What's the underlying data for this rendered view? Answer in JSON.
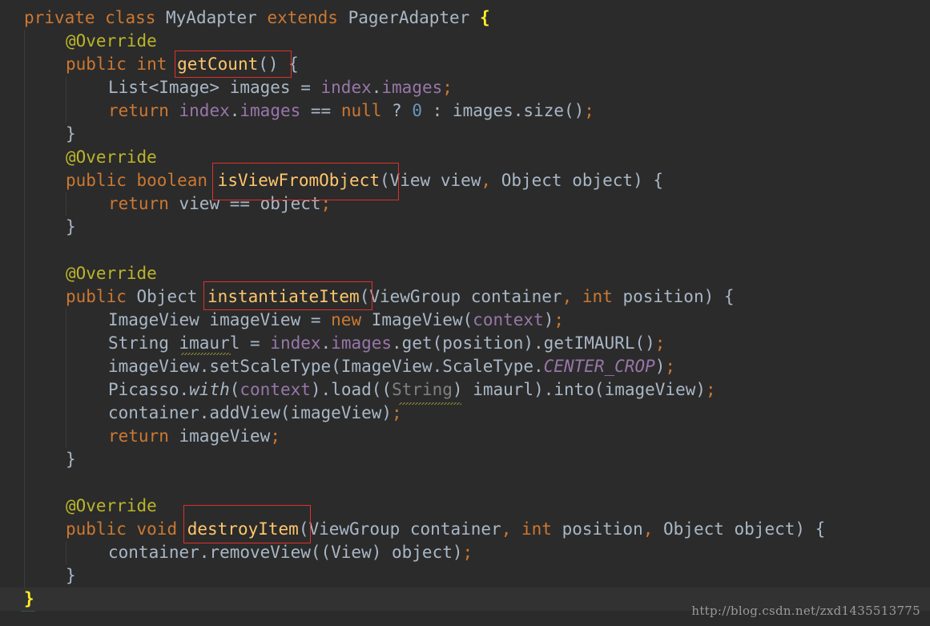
{
  "code": {
    "lines": [
      [
        [
          "k",
          "private "
        ],
        [
          "k",
          "class "
        ],
        [
          "t",
          "MyAdapter "
        ],
        [
          "k",
          "extends "
        ],
        [
          "t",
          "PagerAdapter "
        ],
        [
          "b",
          "{"
        ]
      ],
      [
        [
          "a",
          "@Override"
        ]
      ],
      [
        [
          "k",
          "public "
        ],
        [
          "k",
          "int "
        ],
        [
          "f",
          "getCount"
        ],
        [
          "t",
          "() {"
        ]
      ],
      [
        [
          "t",
          "List<Image> images = "
        ],
        [
          "p",
          "index"
        ],
        [
          "t",
          "."
        ],
        [
          "p",
          "images"
        ],
        [
          "k",
          ";"
        ]
      ],
      [
        [
          "k",
          "return "
        ],
        [
          "p",
          "index"
        ],
        [
          "t",
          "."
        ],
        [
          "p",
          "images"
        ],
        [
          "t",
          " == "
        ],
        [
          "k",
          "null "
        ],
        [
          "t",
          "? "
        ],
        [
          "n",
          "0"
        ],
        [
          "t",
          " : images.size()"
        ],
        [
          "k",
          ";"
        ]
      ],
      [
        [
          "t",
          "}"
        ]
      ],
      [
        [
          "a",
          "@Override"
        ]
      ],
      [
        [
          "k",
          "public "
        ],
        [
          "k",
          "boolean "
        ],
        [
          "f",
          "isViewFromObject"
        ],
        [
          "t",
          "(View view"
        ],
        [
          "k",
          ", "
        ],
        [
          "t",
          "Object object) {"
        ]
      ],
      [
        [
          "k",
          "return "
        ],
        [
          "t",
          "view == object"
        ],
        [
          "k",
          ";"
        ]
      ],
      [
        [
          "t",
          "}"
        ]
      ],
      [],
      [
        [
          "a",
          "@Override"
        ]
      ],
      [
        [
          "k",
          "public "
        ],
        [
          "t",
          "Object "
        ],
        [
          "f",
          "instantiateItem"
        ],
        [
          "t",
          "(ViewGroup container"
        ],
        [
          "k",
          ", "
        ],
        [
          "k",
          "int "
        ],
        [
          "t",
          "position) {"
        ]
      ],
      [
        [
          "t",
          "ImageView imageView = "
        ],
        [
          "k",
          "new "
        ],
        [
          "t",
          "ImageView("
        ],
        [
          "p",
          "context"
        ],
        [
          "t",
          ")"
        ],
        [
          "k",
          ";"
        ]
      ],
      [
        [
          "t",
          "String imaurl = "
        ],
        [
          "p",
          "index"
        ],
        [
          "t",
          "."
        ],
        [
          "p",
          "images"
        ],
        [
          "t",
          ".get(position).getIMAURL()"
        ],
        [
          "k",
          ";"
        ]
      ],
      [
        [
          "t",
          "imageView.setScaleType(ImageView.ScaleType."
        ],
        [
          "s",
          "CENTER_CROP"
        ],
        [
          "t",
          ")"
        ],
        [
          "k",
          ";"
        ]
      ],
      [
        [
          "t",
          "Picasso."
        ],
        [
          "m",
          "with"
        ],
        [
          "t",
          "("
        ],
        [
          "p",
          "context"
        ],
        [
          "t",
          ").load(("
        ],
        [
          "d",
          "String"
        ],
        [
          "t",
          ") imaurl).into(imageView)"
        ],
        [
          "k",
          ";"
        ]
      ],
      [
        [
          "t",
          "container.addView(imageView)"
        ],
        [
          "k",
          ";"
        ]
      ],
      [
        [
          "k",
          "return "
        ],
        [
          "t",
          "imageView"
        ],
        [
          "k",
          ";"
        ]
      ],
      [
        [
          "t",
          "}"
        ]
      ],
      [],
      [
        [
          "a",
          "@Override"
        ]
      ],
      [
        [
          "k",
          "public "
        ],
        [
          "k",
          "void "
        ],
        [
          "f",
          "destroyItem"
        ],
        [
          "t",
          "(ViewGroup container"
        ],
        [
          "k",
          ", "
        ],
        [
          "k",
          "int "
        ],
        [
          "t",
          "position"
        ],
        [
          "k",
          ", "
        ],
        [
          "t",
          "Object object) {"
        ]
      ],
      [
        [
          "t",
          "container.removeView((View) object)"
        ],
        [
          "k",
          ";"
        ]
      ],
      [
        [
          "t",
          "}"
        ]
      ],
      [
        [
          "b",
          "}"
        ]
      ]
    ]
  },
  "highlights": [
    "getCount()",
    "isViewFromObject",
    "instantiateItem",
    "destroyItem"
  ],
  "watermark": "http://blog.csdn.net/zxd1435513775",
  "colors": {
    "background": "#2b2b2b",
    "keyword": "#cc7832",
    "annotation": "#bbb529",
    "method": "#ffc66d",
    "field": "#9876aa",
    "number": "#6897bb",
    "text": "#a9b7c6",
    "highlight_box": "#e0302a"
  }
}
